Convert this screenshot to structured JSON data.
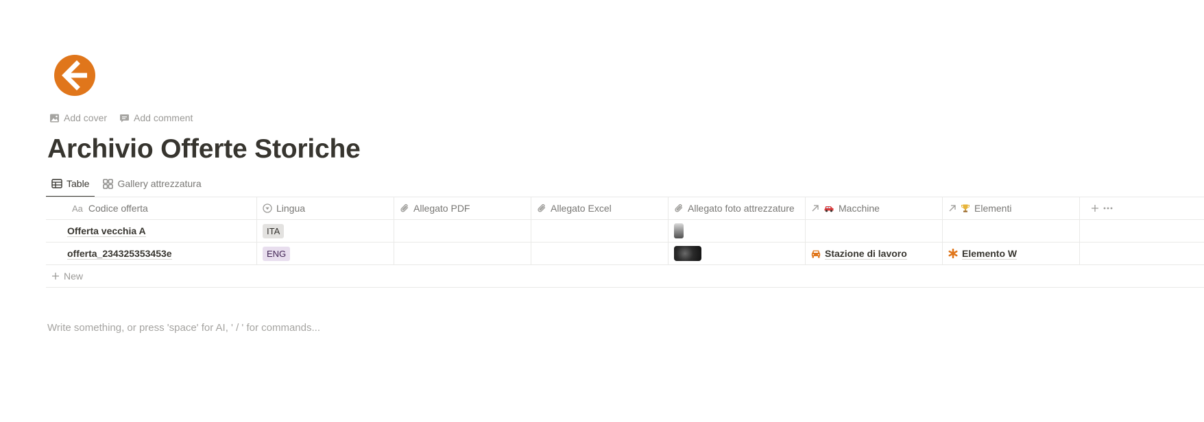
{
  "page": {
    "icon": "arrow-left-circle-icon",
    "accent_color": "#e0761b",
    "actions": {
      "add_cover": "Add cover",
      "add_comment": "Add comment"
    },
    "title": "Archivio Offerte Storiche",
    "placeholder": "Write something, or press 'space' for AI, ' / ' for commands..."
  },
  "tabs": [
    {
      "label": "Table",
      "icon": "table-icon",
      "active": true
    },
    {
      "label": "Gallery attrezzatura",
      "icon": "gallery-icon",
      "active": false
    }
  ],
  "table": {
    "columns": [
      {
        "label": "Codice offerta",
        "icon": "Aa"
      },
      {
        "label": "Lingua",
        "icon": "select-icon"
      },
      {
        "label": "Allegato PDF",
        "icon": "paperclip-icon"
      },
      {
        "label": "Allegato Excel",
        "icon": "paperclip-icon"
      },
      {
        "label": "Allegato foto attrezzature",
        "icon": "paperclip-icon"
      },
      {
        "label": "Macchine",
        "icon": "car-emoji"
      },
      {
        "label": "Elementi",
        "icon": "trophy-emoji"
      }
    ],
    "rows": [
      {
        "codice": "Offerta vecchia A",
        "lingua": "ITA",
        "foto": "bottle-thumbnail",
        "macchine": "",
        "elementi": ""
      },
      {
        "codice": "offerta_234325353453e",
        "lingua": "ENG",
        "foto": "machine-thumbnail",
        "macchine": "Stazione di lavoro",
        "elementi": "Elemento W"
      }
    ],
    "new_label": "New"
  }
}
